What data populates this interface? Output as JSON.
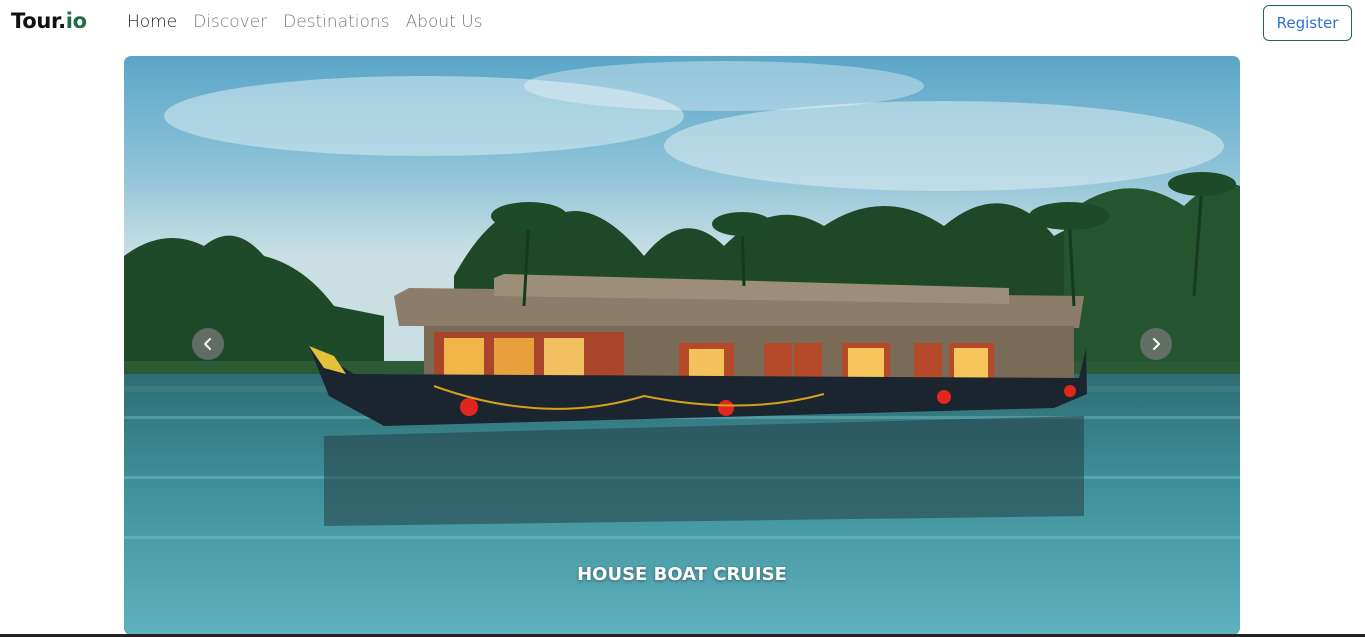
{
  "navbar": {
    "brand_main": "Tour.",
    "brand_accent": "io",
    "links": [
      {
        "label": "Home",
        "active": true
      },
      {
        "label": "Discover",
        "active": false
      },
      {
        "label": "Destinations",
        "active": false
      },
      {
        "label": "About Us",
        "active": false
      }
    ],
    "register_label": "Register"
  },
  "carousel": {
    "caption": "HOUSE BOAT CRUISE",
    "prev_icon": "chevron-left-icon",
    "next_icon": "chevron-right-icon"
  },
  "colors": {
    "brand_accent": "#1f6b45",
    "register_text": "#2f6fd6",
    "nav_active": "#212121",
    "nav_inactive": "#7a7a7a"
  }
}
